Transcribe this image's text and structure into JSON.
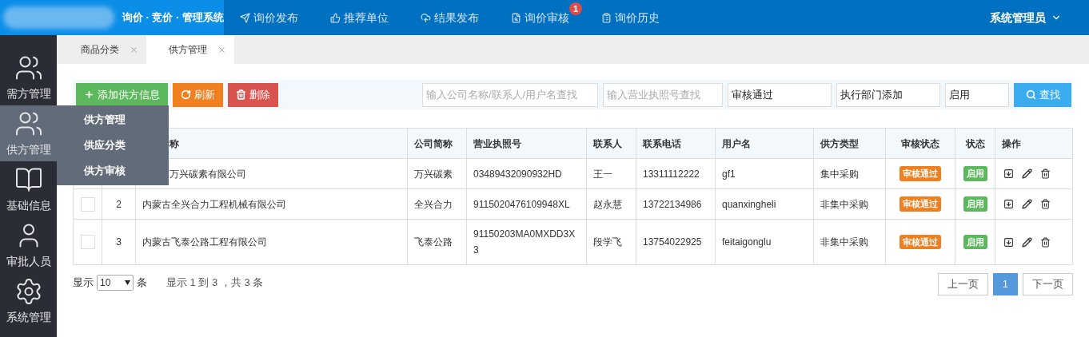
{
  "header": {
    "system_title": "询价 · 竞价 · 管理系统",
    "nav": [
      {
        "label": "询价发布"
      },
      {
        "label": "推荐单位"
      },
      {
        "label": "结果发布"
      },
      {
        "label": "询价审核",
        "badge": "1"
      },
      {
        "label": "询价历史"
      }
    ],
    "user": "系统管理员"
  },
  "sidebar": {
    "items": [
      {
        "label": "需方管理",
        "selected": false
      },
      {
        "label": "供方管理",
        "selected": true,
        "expanded": true,
        "children": [
          {
            "label": "供方管理"
          },
          {
            "label": "供应分类"
          },
          {
            "label": "供方审核"
          }
        ]
      },
      {
        "label": "基础信息",
        "selected": false
      },
      {
        "label": "审批人员",
        "selected": false
      },
      {
        "label": "系统管理",
        "selected": false
      }
    ]
  },
  "tabs": [
    {
      "label": "商品分类",
      "selected": false
    },
    {
      "label": "供方管理",
      "selected": true
    }
  ],
  "toolbar": {
    "buttons": [
      {
        "label": "添加供方信息",
        "kind": "add"
      },
      {
        "label": "刷新",
        "kind": "refresh"
      },
      {
        "label": "删除",
        "kind": "delete"
      }
    ],
    "filters": [
      {
        "placeholder": "输入公司名称/联系人/用户名查找"
      },
      {
        "placeholder": "输入营业执照号查找"
      },
      {
        "value": "审核通过"
      },
      {
        "value": "执行部门添加"
      },
      {
        "value": "启用"
      }
    ],
    "search_button": "查找"
  },
  "table": {
    "columns": [
      "",
      "",
      "称",
      "公司简称",
      "营业执照号",
      "联系人",
      "联系电话",
      "用户名",
      "供方类型",
      "审核状态",
      "状态",
      "操作"
    ],
    "rows": [
      {
        "name": "万兴碳素有限公司",
        "short": "万兴碳素",
        "license": "03489432090932HD",
        "contact": "王一",
        "phone": "13311112222",
        "username": "gf1",
        "type": "集中采购",
        "audit": "审核通过",
        "status": "启用"
      },
      {
        "checked": false,
        "no": "2",
        "name": "内蒙古全兴合力工程机械有限公司",
        "short": "全兴合力",
        "license": "9115020476109948XL",
        "contact": "赵永慧",
        "phone": "13722134986",
        "username": "quanxingheli",
        "type": "非集中采购",
        "audit": "审核通过",
        "status": "启用"
      },
      {
        "checked": false,
        "no": "3",
        "name": "内蒙古飞泰公路工程有限公司",
        "short": "飞泰公路",
        "license": "91150203MA0MXDD3X3",
        "contact": "段学飞",
        "phone": "13754022925",
        "username": "feitaigonglu",
        "type": "非集中采购",
        "audit": "审核通过",
        "status": "启用"
      }
    ]
  },
  "footer": {
    "show_label": "显示",
    "page_size": "10",
    "unit": "条",
    "summary": "显示 1 到 3 ，共 3 条",
    "pagination": [
      {
        "label": "上一页",
        "selected": false
      },
      {
        "label": "1",
        "selected": true
      },
      {
        "label": "下一页",
        "selected": false
      }
    ]
  }
}
